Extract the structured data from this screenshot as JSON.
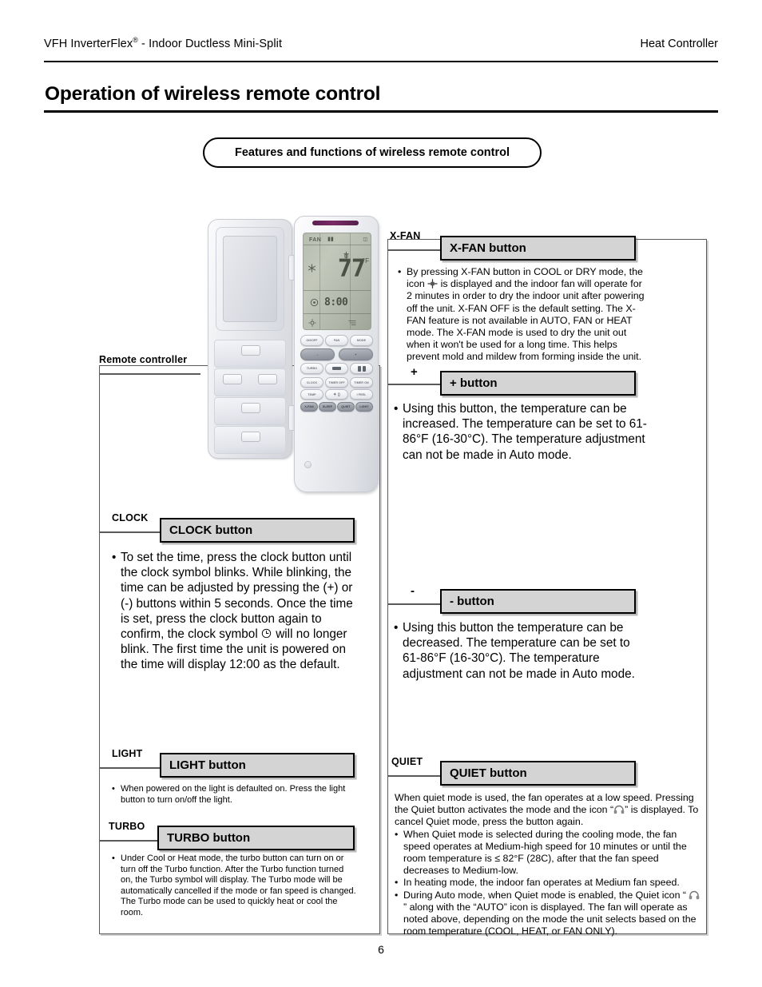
{
  "header": {
    "left_main": "VFH InverterFlex",
    "left_sup": "®",
    "left_rest": " - Indoor Ductless Mini-Split",
    "right": "Heat Controller"
  },
  "page_title": "Operation of wireless remote control",
  "banner": "Features and functions of wireless remote control",
  "page_number": "6",
  "diagram": {
    "remote_label": "Remote controller",
    "lcd": {
      "mode": "FAN",
      "temperature": "77",
      "unit": "°F",
      "clock": "8:00"
    },
    "keys": {
      "row1": [
        "ON/OFF",
        "FAN",
        "MODE"
      ],
      "row2": [
        "-",
        "+"
      ],
      "row3": [
        "TURBO",
        "",
        ""
      ],
      "row4": [
        "CLOCK",
        "TIMER OFF",
        "TIMER ON"
      ],
      "row5": [
        "TEMP",
        "",
        "I FEEL"
      ],
      "row6": [
        "X-FAN",
        "SLEEP",
        "QUIET",
        "LIGHT"
      ]
    }
  },
  "callouts": {
    "xfan": {
      "tag": "X-FAN",
      "heading": "X-FAN button",
      "body": [
        "By pressing X-FAN button in COOL or DRY mode, the icon ",
        " is displayed and the indoor fan will operate for 2 minutes in order to dry the indoor unit after powering off the unit. X-FAN OFF is the default setting. The X-FAN feature is not available in AUTO, FAN or HEAT mode. The X-FAN mode is used to dry the unit out when it won't be used for a long time. This helps prevent mold and mildew from forming inside the unit."
      ]
    },
    "plus": {
      "tag": "+",
      "heading": "+ button",
      "body": "Using this button, the temperature can be increased. The temperature can be set to 61-86°F (16-30°C). The temperature adjustment can not be made in Auto mode."
    },
    "minus": {
      "tag": "-",
      "heading": "- button",
      "body": "Using this button the temperature can be decreased. The temperature can be set to 61-86°F (16-30°C). The temperature adjustment can not be made in Auto mode."
    },
    "clock": {
      "tag": "CLOCK",
      "heading": "CLOCK button",
      "body_part1": "To set the time, press the clock button until the clock symbol blinks. While blinking, the time can be adjusted by pressing the (+) or (-) buttons within 5 seconds. Once the time is set, press the clock button again to confirm, the clock symbol ",
      "body_part2": " will no longer blink. The first time the unit is powered on the time will display 12:00 as the default."
    },
    "light": {
      "tag": "LIGHT",
      "heading": "LIGHT button",
      "body": "When powered on the light is defaulted on. Press the light button to turn on/off the light."
    },
    "turbo": {
      "tag": "TURBO",
      "heading": "TURBO button",
      "body": "Under Cool or Heat mode, the turbo button can turn on or turn off the Turbo function. After the Turbo function turned on, the Turbo symbol will display. The Turbo mode will be automatically cancelled if the mode or fan speed is changed. The Turbo mode can be used to quickly heat or cool the room."
    },
    "quiet": {
      "tag": "QUIET",
      "heading": "QUIET button",
      "intro_part1": "When quiet mode is used, the fan operates at a low speed. Pressing the Quiet button activates the mode and the icon “",
      "intro_part2": "” is displayed. To cancel Quiet mode, press the button again.",
      "bullet1": "When Quiet mode is selected during the cooling mode, the fan speed operates at Medium-high speed for 10 minutes or until the room temperature is ≤ 82°F (28C), after that the fan speed decreases to Medium-low.",
      "bullet2": "In heating mode, the indoor fan operates at Medium fan speed.",
      "bullet3_part1": "During Auto mode, when Quiet mode is enabled, the Quiet icon “ ",
      "bullet3_part2": " ” along with the “AUTO” icon is displayed. The fan will operate as noted above, depending on the mode the unit selects based on the room temperature (COOL, HEAT, or FAN ONLY)."
    }
  },
  "colors": {
    "heading_box_fill": "#d4d4d4",
    "rule": "#000000",
    "frame_border": "#5a5a5a"
  }
}
